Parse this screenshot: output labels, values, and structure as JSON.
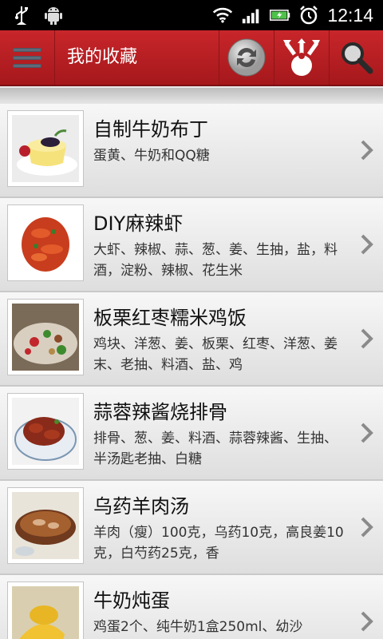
{
  "status_bar": {
    "time": "12:14",
    "icons": [
      "usb-icon",
      "android-icon",
      "wifi-icon",
      "signal-icon",
      "battery-charging-icon",
      "alarm-icon"
    ]
  },
  "header": {
    "title": "我的收藏",
    "buttons": [
      "menu-icon",
      "refresh-icon",
      "share-icon",
      "search-icon"
    ],
    "colors": {
      "bar": "#b51e22",
      "icon_gray": "#5f6a7a"
    }
  },
  "recipes": [
    {
      "title": "自制牛奶布丁",
      "ingredients": "蛋黄、牛奶和QQ糖"
    },
    {
      "title": "DIY麻辣虾",
      "ingredients": "大虾、辣椒、蒜、葱、姜、生抽，盐，料酒，淀粉、辣椒、花生米"
    },
    {
      "title": "板栗红枣糯米鸡饭",
      "ingredients": "鸡块、洋葱、姜、板栗、红枣、洋葱、姜末、老抽、料酒、盐、鸡"
    },
    {
      "title": "蒜蓉辣酱烧排骨",
      "ingredients": "排骨、葱、姜、料酒、蒜蓉辣酱、生抽、半汤匙老抽、白糖"
    },
    {
      "title": "乌药羊肉汤",
      "ingredients": "羊肉（瘦）100克，乌药10克，高良姜10克，白芍药25克，香"
    },
    {
      "title": "牛奶炖蛋",
      "ingredients": "鸡蛋2个、纯牛奶1盒250ml、幼沙"
    }
  ]
}
